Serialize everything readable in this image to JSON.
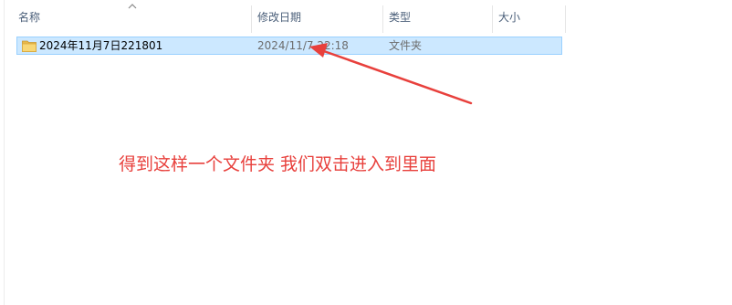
{
  "columns": {
    "name": "名称",
    "modified": "修改日期",
    "type": "类型",
    "size": "大小"
  },
  "sort_icon": "chevron-up-icon",
  "rows": [
    {
      "icon": "folder-icon",
      "name": "2024年11月7日221801",
      "modified": "2024/11/7 22:18",
      "type": "文件夹",
      "size": ""
    }
  ],
  "annotation": {
    "text": "得到这样一个文件夹 我们双击进入到里面",
    "color": "#e8403c"
  },
  "colors": {
    "selection_bg": "#cce8ff",
    "selection_border": "#99d1ff",
    "header_text": "#4c607a",
    "folder": "#f8d775"
  }
}
